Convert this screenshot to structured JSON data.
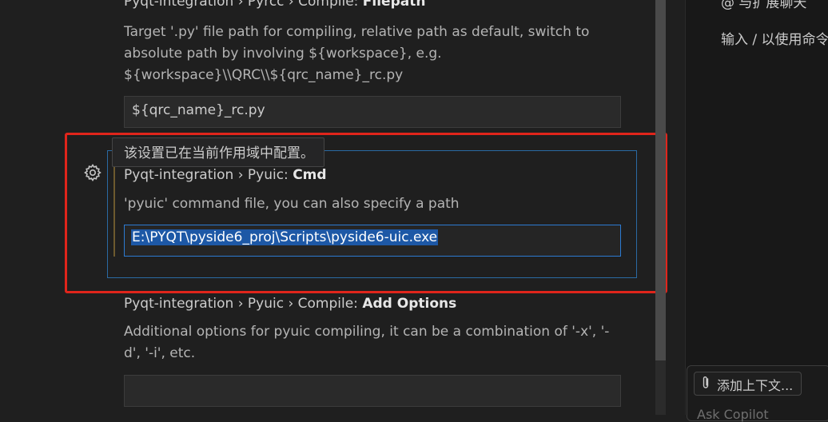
{
  "settings": {
    "pyrcc_filepath": {
      "title_prefix": "Pyqt-integration › Pyrcc › Compile: ",
      "title_name": "Filepath",
      "description": "Target '.py' file path for compiling, relative path as default, switch to absolute path by involving ${workspace}, e.g. ${workspace}\\\\QRC\\\\${qrc_name}_rc.py",
      "value": "${qrc_name}_rc.py"
    },
    "pyuic_cmd": {
      "title_prefix": "Pyqt-integration › Pyuic: ",
      "title_name": "Cmd",
      "description": "'pyuic' command file, you can also specify a path",
      "value": "E:\\PYQT\\pyside6_proj\\Scripts\\pyside6-uic.exe",
      "tooltip": "该设置已在当前作用域中配置。"
    },
    "pyuic_add_options": {
      "title_prefix": "Pyqt-integration › Pyuic › Compile: ",
      "title_name": "Add Options",
      "description": "Additional options for pyuic compiling, it can be a combination of '-x', '-d', '-i', etc.",
      "value": ""
    }
  },
  "chat": {
    "line1": "@ 与扩展聊天",
    "line2": "输入 / 以使用命令",
    "add_context_label": "添加上下文...",
    "placeholder": "Ask Copilot"
  },
  "colors": {
    "highlight_border": "#e0251b",
    "focus_border": "#2c7ad1",
    "selection": "#1d58a6"
  }
}
